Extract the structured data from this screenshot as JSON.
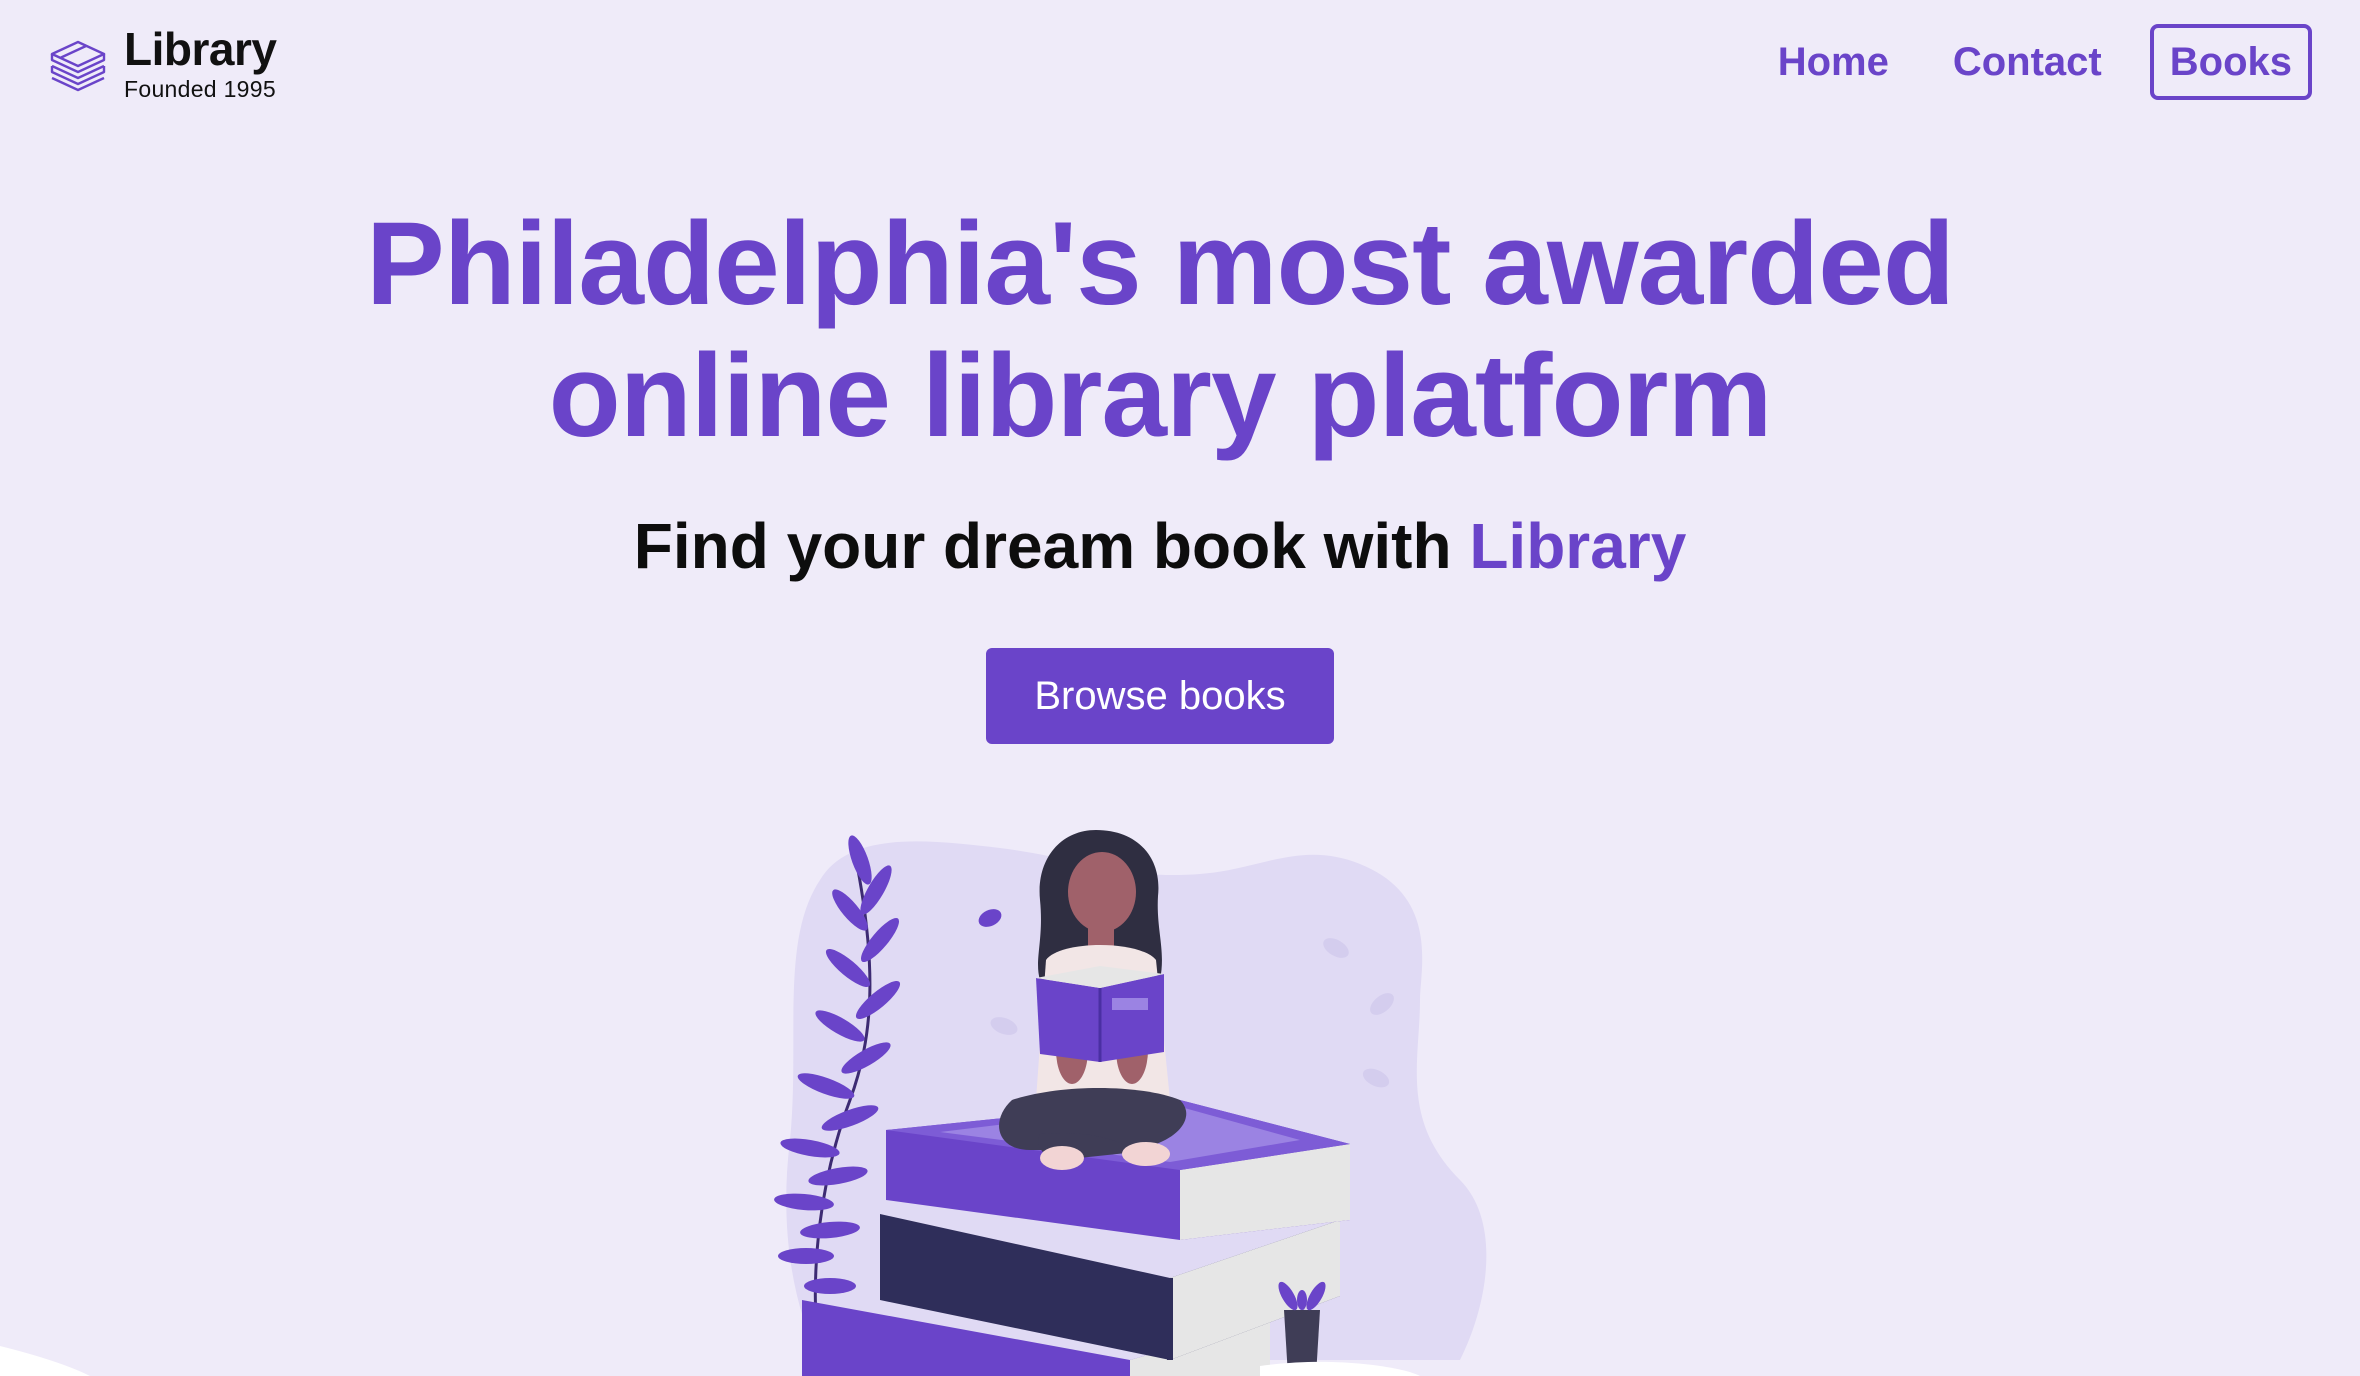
{
  "brand": {
    "name": "Library",
    "tagline": "Founded 1995",
    "logo_icon": "stacked-books-icon"
  },
  "nav": {
    "items": [
      {
        "label": "Home",
        "style": "text"
      },
      {
        "label": "Contact",
        "style": "text"
      },
      {
        "label": "Books",
        "style": "outlined"
      }
    ]
  },
  "hero": {
    "title_line1": "Philadelphia's most awarded",
    "title_line2": "online library platform",
    "subtitle_prefix": "Find your dream book with ",
    "subtitle_accent": "Library",
    "cta_label": "Browse books",
    "illustration": "woman-reading-on-book-stack-illustration"
  },
  "colors": {
    "accent": "#6a44c9",
    "background": "#efebf9",
    "text": "#0d0d0d"
  }
}
